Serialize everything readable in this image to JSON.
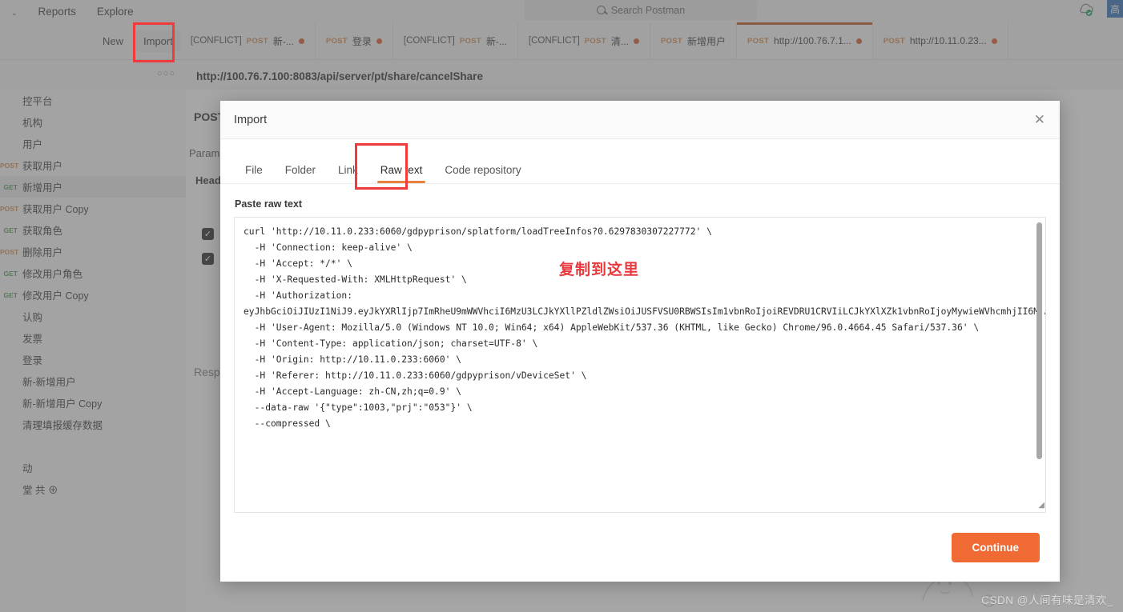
{
  "topbar": {
    "workspace_chevron": "⌄",
    "items": [
      {
        "label": "Reports"
      },
      {
        "label": "Explore"
      }
    ],
    "search": {
      "placeholder": "Search Postman",
      "icon": "search-icon"
    },
    "cloud_icon": "cloud-sync-icon",
    "avatar_label": "高"
  },
  "tabstrip": {
    "new_label": "New",
    "import_label": "Import",
    "tabs": [
      {
        "conflict": "[CONFLICT]",
        "method": "POST",
        "name": "新-...",
        "dirty": true,
        "active": false
      },
      {
        "conflict": "",
        "method": "POST",
        "name": "登录",
        "dirty": true,
        "active": false
      },
      {
        "conflict": "[CONFLICT]",
        "method": "POST",
        "name": "新-...",
        "dirty": false,
        "active": false
      },
      {
        "conflict": "[CONFLICT]",
        "method": "POST",
        "name": "清...",
        "dirty": true,
        "active": false
      },
      {
        "conflict": "",
        "method": "POST",
        "name": "新增用户",
        "dirty": false,
        "active": false
      },
      {
        "conflict": "",
        "method": "POST",
        "name": "http://100.76.7.1...",
        "dirty": true,
        "active": true
      },
      {
        "conflict": "",
        "method": "POST",
        "name": "http://10.11.0.23...",
        "dirty": true,
        "active": false
      }
    ]
  },
  "request": {
    "options_dots": "○○○",
    "url": "http://100.76.7.100:8083/api/server/pt/share/cancelShare",
    "method": "POST",
    "tab_params": "Param",
    "tab_headers": "Head",
    "response_label": "Respo"
  },
  "sidebar": {
    "items": [
      {
        "method": "",
        "label": "控平台",
        "selected": false
      },
      {
        "method": "",
        "label": "机构",
        "selected": false
      },
      {
        "method": "",
        "label": "用户",
        "selected": false
      },
      {
        "method": "POST",
        "mclass": "post",
        "label": "获取用户",
        "selected": false
      },
      {
        "method": "GET",
        "mclass": "get",
        "label": "新增用户",
        "selected": true
      },
      {
        "method": "POST",
        "mclass": "post",
        "label": "获取用户 Copy",
        "selected": false
      },
      {
        "method": "GET",
        "mclass": "get",
        "label": "获取角色",
        "selected": false
      },
      {
        "method": "POST",
        "mclass": "post",
        "label": "删除用户",
        "selected": false
      },
      {
        "method": "GET",
        "mclass": "get",
        "label": "修改用户角色",
        "selected": false
      },
      {
        "method": "GET",
        "mclass": "get",
        "label": "修改用户 Copy",
        "selected": false
      },
      {
        "method": "",
        "label": "认购",
        "selected": false
      },
      {
        "method": "",
        "label": "发票",
        "selected": false
      },
      {
        "method": "",
        "label": "登录",
        "selected": false
      },
      {
        "method": "",
        "label": "新-新增用户",
        "selected": false
      },
      {
        "method": "",
        "label": "新-新增用户 Copy",
        "selected": false
      },
      {
        "method": "",
        "label": "清理填报缓存数据",
        "selected": false
      },
      {
        "method": "",
        "label": "",
        "selected": false
      },
      {
        "method": "",
        "label": "动",
        "selected": false
      },
      {
        "method": "",
        "label": "堂 共 ⊕",
        "selected": false
      }
    ]
  },
  "modal": {
    "title": "Import",
    "close_icon": "close-icon",
    "tabs": [
      {
        "label": "File",
        "active": false
      },
      {
        "label": "Folder",
        "active": false
      },
      {
        "label": "Link",
        "active": false
      },
      {
        "label": "Raw text",
        "active": true
      },
      {
        "label": "Code repository",
        "active": false
      }
    ],
    "paste_label": "Paste raw text",
    "raw_text": "curl 'http://10.11.0.233:6060/gdpyprison/splatform/loadTreeInfos?0.6297830307227772' \\\n  -H 'Connection: keep-alive' \\\n  -H 'Accept: */*' \\\n  -H 'X-Requested-With: XMLHttpRequest' \\\n  -H 'Authorization:\neyJhbGciOiJIUzI1NiJ9.eyJkYXRlIjp7ImRheU9mWWVhciI6MzU3LCJkYXllPZldlZWsiOiJUSFVSU0RBWSIsIm1vbnRoIjoiREVDRU1CRVIiLCJkYXlXZk1vbnRoIjoyMywieWVhcmhjII6MjAyMSwibW9udGhWYWx1ZSI6MTIsImhvdXIiOjE0LCJtaW51dGUiOjE0LCJzZWNvbmQiOjQzLCJuYW5vIjoxODAwMDAwMCwiY2hyb25vbG9neSI6eyJjYWxlbmRhclR5cGUiOiJJU08ifX0sImlkIjoiJU08ifX0sInByaiI6IjA1MyIsInVzZXJuYW1lIjoiYWRtaW4iLCJ0b2tlbiI6ImI2ODc2NWI5LTUzOTgtNDAzYi05NmE2LTJlM2U1MGRhNzgyNiJ9.uArMKQGdWeHKiV0S4Cr4xByyFdaUqiul0zcNb39hx10' \\\n  -H 'User-Agent: Mozilla/5.0 (Windows NT 10.0; Win64; x64) AppleWebKit/537.36 (KHTML, like Gecko) Chrome/96.0.4664.45 Safari/537.36' \\\n  -H 'Content-Type: application/json; charset=UTF-8' \\\n  -H 'Origin: http://10.11.0.233:6060' \\\n  -H 'Referer: http://10.11.0.233:6060/gdpyprison/vDeviceSet' \\\n  -H 'Accept-Language: zh-CN,zh;q=0.9' \\\n  --data-raw '{\"type\":1003,\"prj\":\"053\"}' \\\n  --compressed \\",
    "annotation": "复制到这里",
    "continue_label": "Continue"
  },
  "watermark": "CSDN @人间有味是清欢_",
  "colors": {
    "accent_orange": "#f06a33",
    "tab_underline": "#e8813a",
    "highlight_red": "#f23a3a",
    "annotation_red": "#e8393f",
    "method_post": "#d08a4e",
    "method_get": "#4f9a56"
  }
}
